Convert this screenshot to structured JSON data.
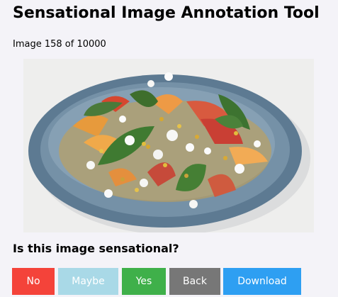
{
  "app": {
    "title": "Sensational Image Annotation Tool"
  },
  "progress": {
    "label": "Image 158 of 10000",
    "current": 158,
    "total": 10000
  },
  "image": {
    "alt": "Salad with peaches, corn, feta cheese and basil on a blue plate"
  },
  "question": {
    "text": "Is this image sensational?"
  },
  "buttons": {
    "no": "No",
    "maybe": "Maybe",
    "yes": "Yes",
    "back": "Back",
    "download": "Download"
  },
  "colors": {
    "no": "#f4433a",
    "maybe": "#a9d9e7",
    "yes": "#3fb04a",
    "back": "#777777",
    "download": "#2e9ff2",
    "background": "#f4f3f8"
  }
}
